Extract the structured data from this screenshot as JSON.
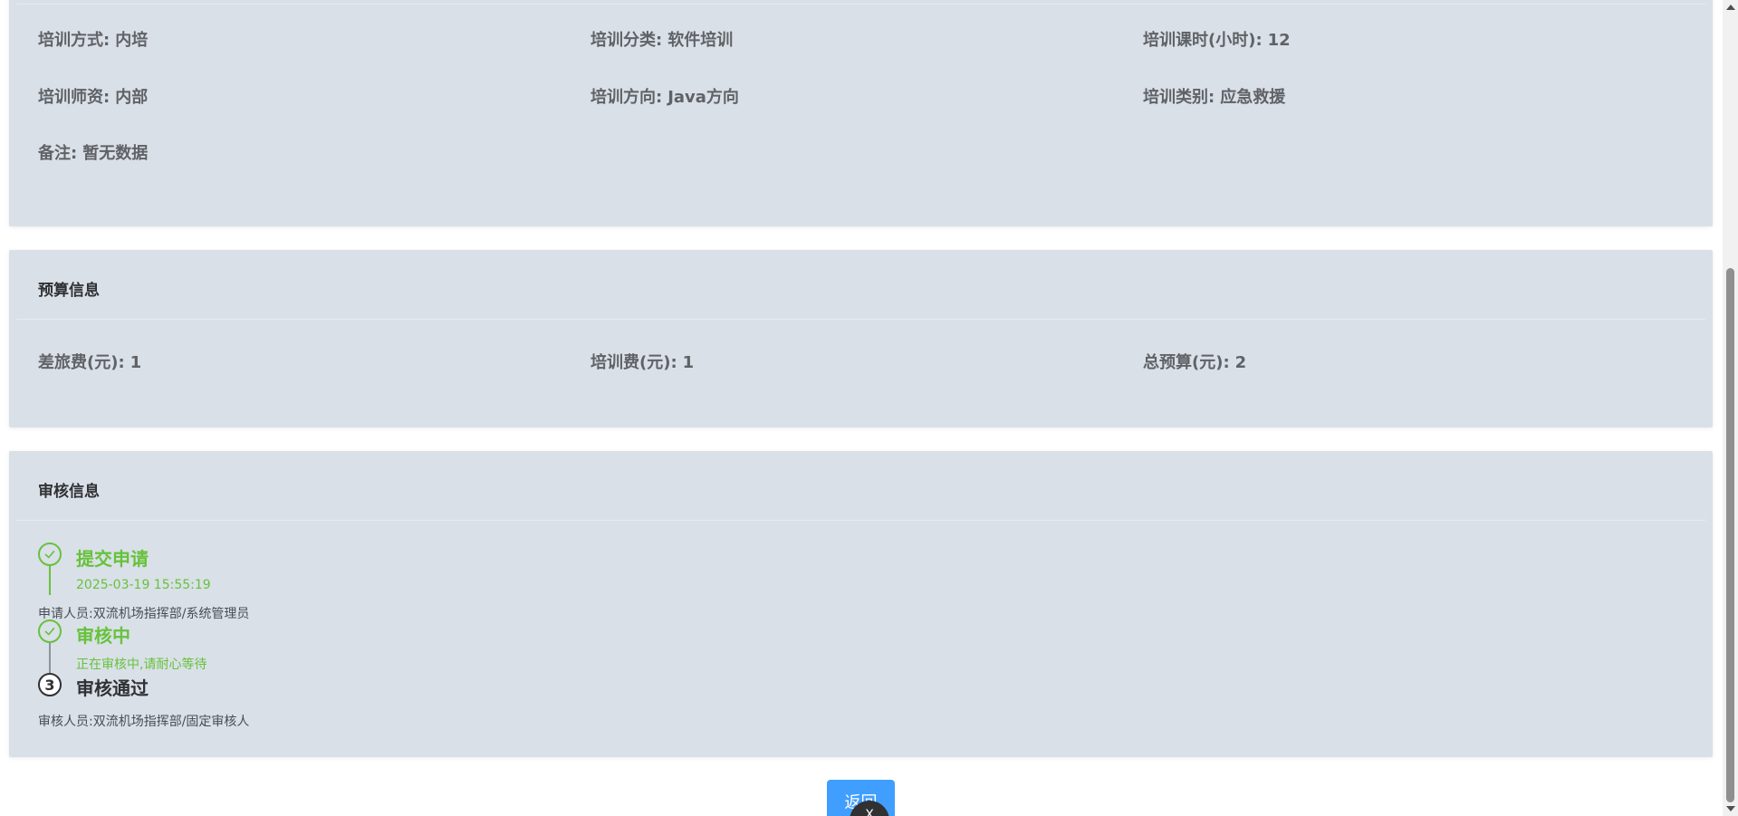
{
  "basic": {
    "fields": [
      {
        "label": "培训方式:",
        "value": "内培"
      },
      {
        "label": "培训分类:",
        "value": "软件培训"
      },
      {
        "label": "培训课时(小时):",
        "value": "12"
      },
      {
        "label": "培训师资:",
        "value": "内部"
      },
      {
        "label": "培训方向:",
        "value": "Java方向"
      },
      {
        "label": "培训类别:",
        "value": "应急救援"
      },
      {
        "label": "备注:",
        "value": "暂无数据"
      }
    ]
  },
  "budget": {
    "title": "预算信息",
    "fields": [
      {
        "label": "差旅费(元):",
        "value": "1"
      },
      {
        "label": "培训费(元):",
        "value": "1"
      },
      {
        "label": "总预算(元):",
        "value": "2"
      }
    ]
  },
  "audit": {
    "title": "审核信息",
    "steps": [
      {
        "title": "提交申请",
        "description": "2025-03-19 15:55:19",
        "note": "申请人员:双流机场指挥部/系统管理员",
        "status": "finished"
      },
      {
        "title": "审核中",
        "description": "正在审核中,请耐心等待",
        "status": "finished"
      },
      {
        "number": "3",
        "title": "审核通过",
        "note": "审核人员:双流机场指挥部/固定审核人",
        "status": "wait"
      }
    ]
  },
  "actions": {
    "back_label": "返回",
    "float_label": "X"
  },
  "colors": {
    "card_bg": "#d9e0e8",
    "success": "#67c23a",
    "primary": "#409eff",
    "text": "#606266",
    "heading": "#303133"
  },
  "icons": {
    "step_done": "check-icon",
    "scroll_up": "triangle-up-icon",
    "scroll_down": "triangle-down-icon"
  }
}
